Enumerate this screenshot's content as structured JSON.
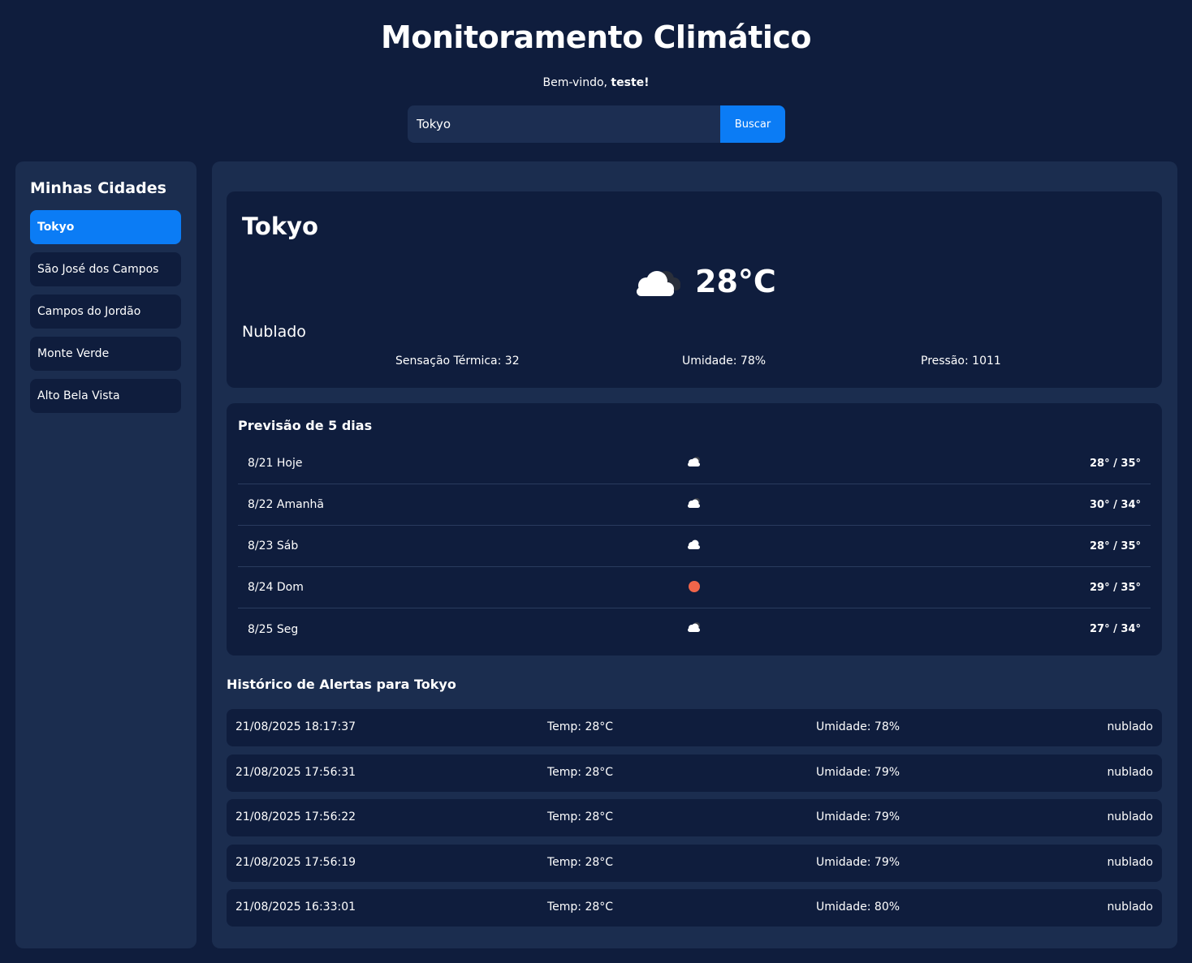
{
  "header": {
    "title": "Monitoramento Climático",
    "welcome_prefix": "Bem-vindo,",
    "username": "teste!"
  },
  "search": {
    "value": "Tokyo",
    "button_label": "Buscar"
  },
  "sidebar": {
    "title": "Minhas Cidades",
    "items": [
      {
        "label": "Tokyo",
        "active": true
      },
      {
        "label": "São José dos Campos"
      },
      {
        "label": "Campos do Jordão"
      },
      {
        "label": "Monte Verde"
      },
      {
        "label": "Alto Bela Vista"
      }
    ]
  },
  "current": {
    "city": "Tokyo",
    "icon": "cloud-icon",
    "temperature": "28°C",
    "description": "Nublado",
    "feels_like": "Sensação Térmica: 32",
    "humidity": "Umidade: 78%",
    "pressure": "Pressão: 1011"
  },
  "forecast": {
    "title": "Previsão de 5 dias",
    "days": [
      {
        "date": "8/21 Hoje",
        "icon": "cloud-icon",
        "range": "28° / 35°"
      },
      {
        "date": "8/22 Amanhã",
        "icon": "cloud-icon",
        "range": "30° / 34°"
      },
      {
        "date": "8/23 Sáb",
        "icon": "cloud-icon",
        "range": "28° / 35°"
      },
      {
        "date": "8/24 Dom",
        "icon": "sun-icon",
        "range": "29° / 35°"
      },
      {
        "date": "8/25 Seg",
        "icon": "cloud-icon",
        "range": "27° / 34°"
      }
    ]
  },
  "history": {
    "title": "Histórico de Alertas para Tokyo",
    "rows": [
      {
        "datetime": "21/08/2025 18:17:37",
        "temp": "Temp: 28°C",
        "humidity": "Umidade: 78%",
        "desc": "nublado"
      },
      {
        "datetime": "21/08/2025 17:56:31",
        "temp": "Temp: 28°C",
        "humidity": "Umidade: 79%",
        "desc": "nublado"
      },
      {
        "datetime": "21/08/2025 17:56:22",
        "temp": "Temp: 28°C",
        "humidity": "Umidade: 79%",
        "desc": "nublado"
      },
      {
        "datetime": "21/08/2025 17:56:19",
        "temp": "Temp: 28°C",
        "humidity": "Umidade: 79%",
        "desc": "nublado"
      },
      {
        "datetime": "21/08/2025 16:33:01",
        "temp": "Temp: 28°C",
        "humidity": "Umidade: 80%",
        "desc": "nublado"
      }
    ]
  },
  "colors": {
    "background": "#0f1d3d",
    "panel": "#1b2d4f",
    "accent": "#0b7cf5",
    "sun": "#f0654a"
  }
}
